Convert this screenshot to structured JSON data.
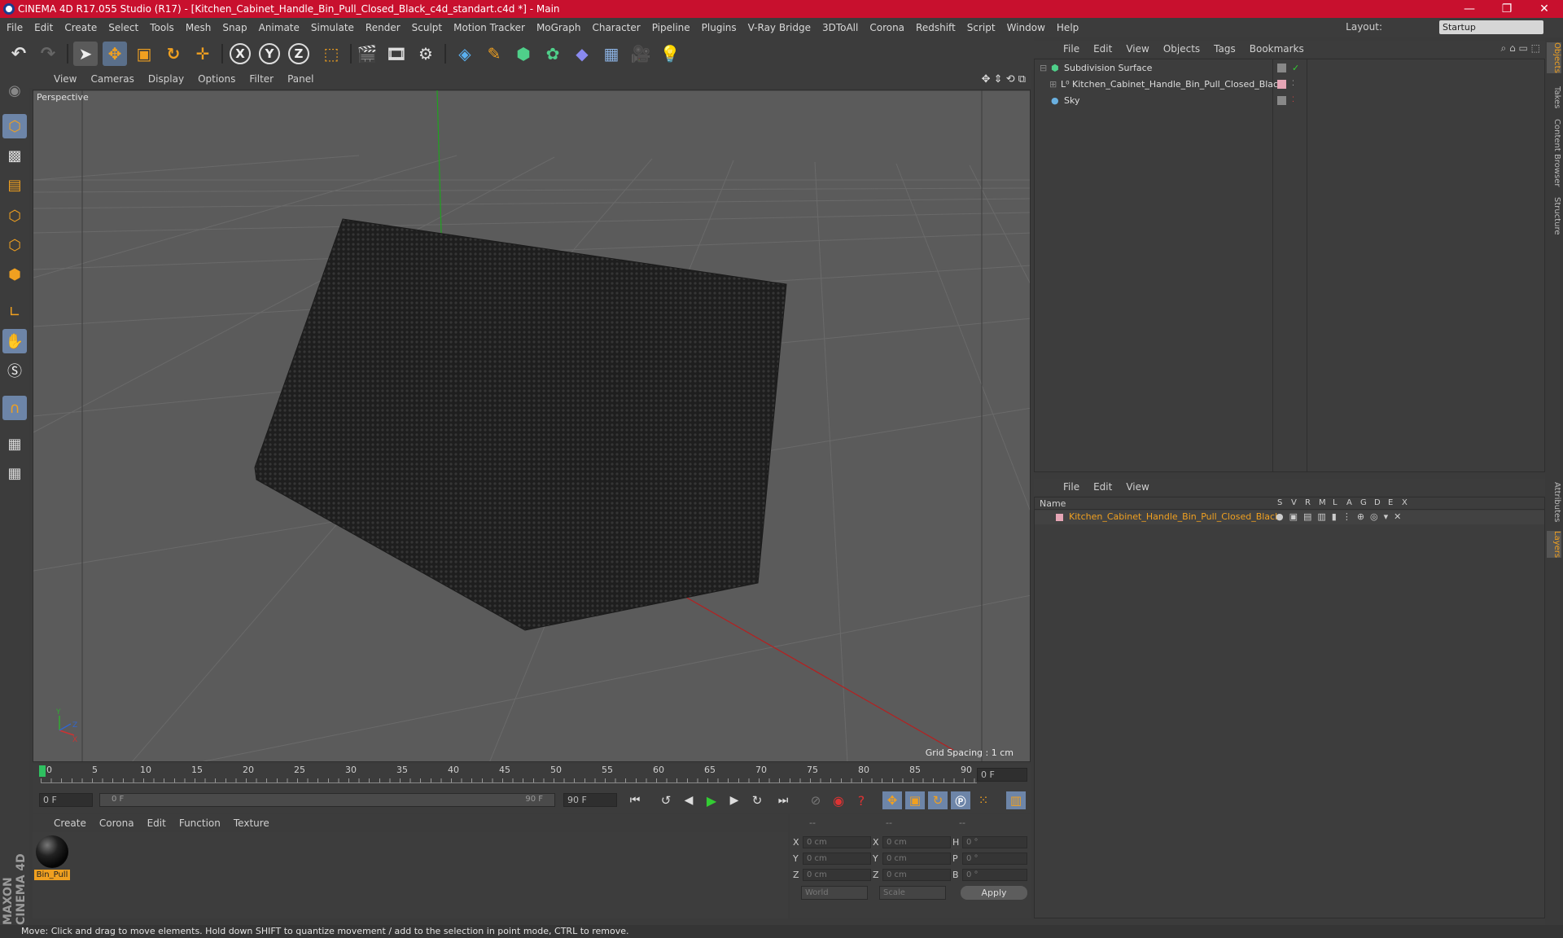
{
  "window": {
    "title": "CINEMA 4D R17.055 Studio (R17) - [Kitchen_Cabinet_Handle_Bin_Pull_Closed_Black_c4d_standart.c4d *] - Main",
    "minimize": "—",
    "maximize": "❐",
    "close": "✕"
  },
  "menu": [
    "File",
    "Edit",
    "Create",
    "Select",
    "Tools",
    "Mesh",
    "Snap",
    "Animate",
    "Simulate",
    "Render",
    "Sculpt",
    "Motion Tracker",
    "MoGraph",
    "Character",
    "Pipeline",
    "Plugins",
    "V-Ray Bridge",
    "3DToAll",
    "Corona",
    "Redshift",
    "Script",
    "Window",
    "Help"
  ],
  "layout": {
    "label": "Layout:",
    "value": "Startup"
  },
  "toolbar": {
    "axis_x": "X",
    "axis_y": "Y",
    "axis_z": "Z"
  },
  "viewport": {
    "menu": [
      "View",
      "Cameras",
      "Display",
      "Options",
      "Filter",
      "Panel"
    ],
    "label": "Perspective",
    "grid_spacing": "Grid Spacing : 1 cm"
  },
  "timeline": {
    "ticks": [
      "0",
      "5",
      "10",
      "15",
      "20",
      "25",
      "30",
      "35",
      "40",
      "45",
      "50",
      "55",
      "60",
      "65",
      "70",
      "75",
      "80",
      "85",
      "90"
    ],
    "current_frame": "0 F"
  },
  "anim": {
    "start_field": "0 F",
    "range_start": "0 F",
    "range_end": "90 F",
    "end_field": "90 F"
  },
  "materials": {
    "menu": [
      "Create",
      "Corona",
      "Edit",
      "Function",
      "Texture"
    ],
    "items": [
      {
        "name": "Bin_Pull"
      }
    ]
  },
  "coords": {
    "header": [
      "--",
      "--",
      "--"
    ],
    "rows": [
      {
        "a": "X",
        "av": "0 cm",
        "b": "X",
        "bv": "0 cm",
        "c": "H",
        "cv": "0 °"
      },
      {
        "a": "Y",
        "av": "0 cm",
        "b": "Y",
        "bv": "0 cm",
        "c": "P",
        "cv": "0 °"
      },
      {
        "a": "Z",
        "av": "0 cm",
        "b": "Z",
        "bv": "0 cm",
        "c": "B",
        "cv": "0 °"
      }
    ],
    "world": "World",
    "scale": "Scale",
    "apply": "Apply"
  },
  "objects": {
    "menu": [
      "File",
      "Edit",
      "View",
      "Objects",
      "Tags",
      "Bookmarks"
    ],
    "items": [
      {
        "name": "Subdivision Surface"
      },
      {
        "name": "Kitchen_Cabinet_Handle_Bin_Pull_Closed_Black"
      },
      {
        "name": "Sky"
      }
    ]
  },
  "layers": {
    "menu": [
      "File",
      "Edit",
      "View"
    ],
    "header": {
      "name": "Name",
      "cols": [
        "S",
        "V",
        "R",
        "M",
        "L",
        "A",
        "G",
        "D",
        "E",
        "X"
      ]
    },
    "items": [
      {
        "name": "Kitchen_Cabinet_Handle_Bin_Pull_Closed_Black"
      }
    ]
  },
  "right_tabs": [
    "Objects",
    "Takes",
    "Content Browser",
    "Structure",
    "Attributes",
    "Layers"
  ],
  "brand": "MAXON CINEMA 4D",
  "status": "Move: Click and drag to move elements. Hold down SHIFT to quantize movement / add to the selection in point mode, CTRL to remove.",
  "colors": {
    "title_bar": "#c8102e",
    "accent": "#f0a020",
    "axis_red": "#c22",
    "axis_green": "#2a2"
  }
}
